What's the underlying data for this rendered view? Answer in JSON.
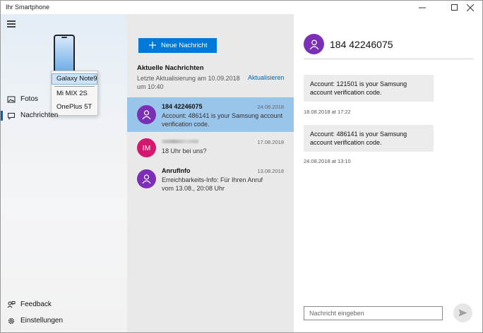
{
  "window": {
    "title": "Ihr Smartphone",
    "controls": [
      "minimize-icon",
      "maximize-icon",
      "close-icon"
    ]
  },
  "nav": {
    "menu_icon": "hamburger-icon",
    "device_selector": {
      "options": [
        "Galaxy Note9",
        "Mi MIX 2S",
        "OnePlus 5T"
      ],
      "selected": "Galaxy Note9"
    },
    "items": [
      {
        "label": "Fotos",
        "icon": "photo-icon"
      },
      {
        "label": "Nachrichten",
        "icon": "message-icon",
        "active": true
      }
    ],
    "footer": [
      {
        "label": "Feedback",
        "icon": "feedback-icon"
      },
      {
        "label": "Einstellungen",
        "icon": "gear-icon"
      }
    ]
  },
  "list": {
    "new_button": "Neue Nachricht",
    "title": "Aktuelle Nachrichten",
    "updated": "Letzte Aktualisierung am 10.09.2018 um 10:40",
    "refresh": "Aktualisieren",
    "conversations": [
      {
        "name": "184 42246075",
        "date": "24.08.2018",
        "snippet": "Account: 486141 is your Samsung account verification code.",
        "avatar": "person-icon",
        "selected": true
      },
      {
        "name": "",
        "initials": "IM",
        "date": "17.08.2018",
        "snippet": "18 Uhr bei uns?",
        "avatar": "initials"
      },
      {
        "name": "AnrufInfo",
        "date": "13.08.2018",
        "snippet": "Erreichbarkeits-Info: Für Ihren Anruf vom 13.08., 20:08 Uhr",
        "avatar": "person-icon"
      }
    ]
  },
  "detail": {
    "contact": "184 42246075",
    "messages": [
      {
        "text": "Account: 121501 is your Samsung account verification code.",
        "time": "18.08.2018 at 17:22"
      },
      {
        "text": "Account: 486141 is your Samsung account verification code.",
        "time": "24.08.2018 at 13:10"
      }
    ],
    "input_placeholder": "Nachricht eingeben",
    "send_icon": "send-icon"
  },
  "colors": {
    "accent": "#0078d7",
    "selected_row": "#99c5ea",
    "avatar_purple": "#7b2fb6",
    "avatar_pink": "#d5176f"
  }
}
